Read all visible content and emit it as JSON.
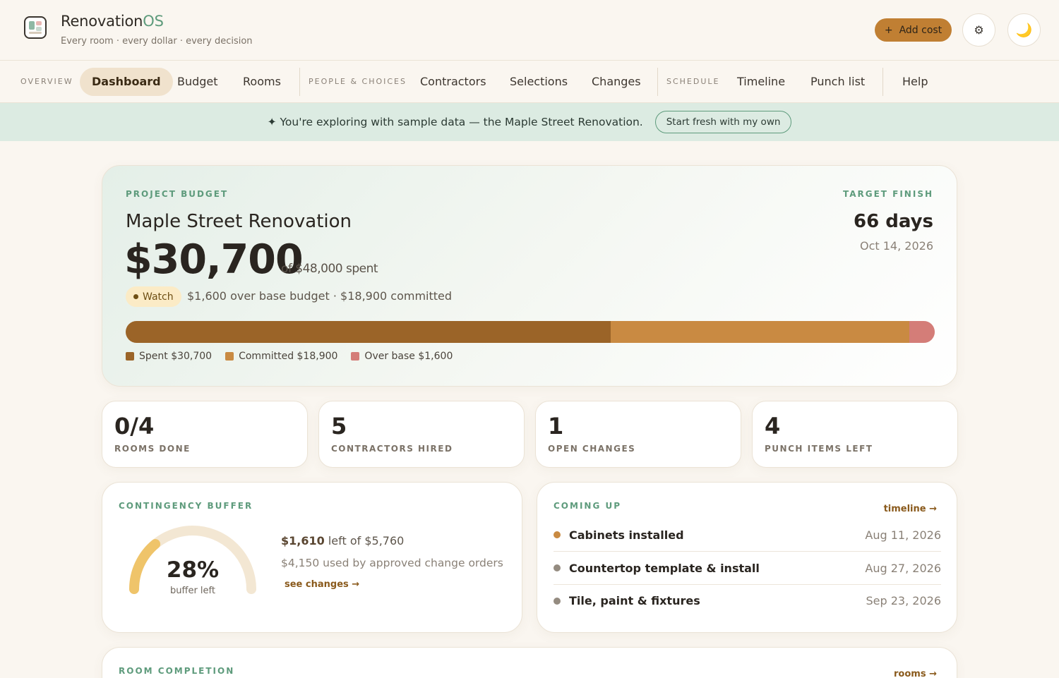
{
  "header": {
    "brand_main": "Renovation",
    "brand_os": "OS",
    "tagline": "Every room · every dollar · every decision",
    "add_cost_icon": "+",
    "add_cost_label": "Add cost",
    "settings_icon": "⚙",
    "theme_icon": "🌙"
  },
  "nav": {
    "sections": [
      "OVERVIEW",
      "PEOPLE & CHOICES",
      "SCHEDULE"
    ],
    "items": [
      "Dashboard",
      "Budget",
      "Rooms",
      "Contractors",
      "Selections",
      "Changes",
      "Timeline",
      "Punch list",
      "Help"
    ],
    "active": "Dashboard"
  },
  "banner": {
    "text": "✦ You're exploring with sample data — the Maple Street Renovation.",
    "button": "Start fresh with my own"
  },
  "budget": {
    "eyebrow": "PROJECT BUDGET",
    "project_name": "Maple Street Renovation",
    "spent": "$30,700",
    "of_total": "of $48,000 spent",
    "status": "Watch",
    "detail": "$1,600 over base budget · $18,900 committed",
    "target_eyebrow": "TARGET FINISH",
    "target_days": "66 days",
    "target_date": "Oct 14, 2026",
    "bar": [
      {
        "name": "Spent",
        "value": 30700,
        "color": "#9b6428"
      },
      {
        "name": "Committed",
        "value": 18900,
        "color": "#c98a42"
      },
      {
        "name": "Over base",
        "value": 1600,
        "color": "#d47d78"
      }
    ],
    "legend": [
      "Spent $30,700",
      "Committed $18,900",
      "Over base $1,600"
    ]
  },
  "stats": [
    {
      "value": "0/4",
      "label": "ROOMS DONE"
    },
    {
      "value": "5",
      "label": "CONTRACTORS HIRED"
    },
    {
      "value": "1",
      "label": "OPEN CHANGES"
    },
    {
      "value": "4",
      "label": "PUNCH ITEMS LEFT"
    }
  ],
  "contingency": {
    "eyebrow": "CONTINGENCY BUFFER",
    "percent_value": 28,
    "percent": "28%",
    "sub": "buffer left",
    "left": "$1,610",
    "left_rest": "left of $5,760",
    "used": "$4,150 used by approved change orders",
    "link": "see changes →",
    "arc_color": "#efc46a",
    "track_color": "#f3e7d3"
  },
  "coming_up": {
    "eyebrow": "COMING UP",
    "link": "timeline →",
    "events": [
      {
        "name": "Cabinets installed",
        "date": "Aug 11, 2026",
        "color": "#c98a42"
      },
      {
        "name": "Countertop template & install",
        "date": "Aug 27, 2026",
        "color": "#948b80"
      },
      {
        "name": "Tile, paint & fixtures",
        "date": "Sep 23, 2026",
        "color": "#948b80"
      }
    ]
  },
  "room_completion": {
    "eyebrow": "ROOM COMPLETION",
    "link": "rooms →"
  }
}
